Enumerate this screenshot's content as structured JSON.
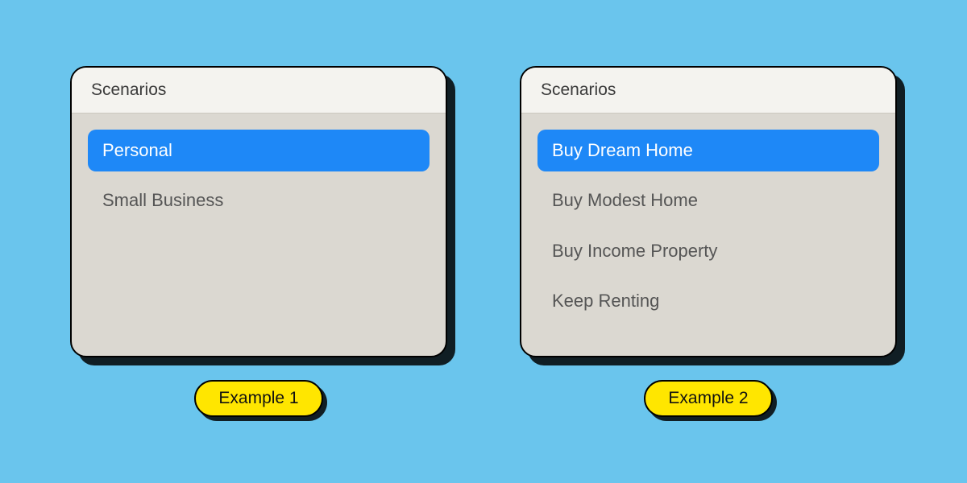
{
  "examples": [
    {
      "header": "Scenarios",
      "badge": "Example 1",
      "items": [
        {
          "label": "Personal",
          "selected": true
        },
        {
          "label": "Small Business",
          "selected": false
        }
      ]
    },
    {
      "header": "Scenarios",
      "badge": "Example 2",
      "items": [
        {
          "label": "Buy Dream Home",
          "selected": true
        },
        {
          "label": "Buy Modest Home",
          "selected": false
        },
        {
          "label": "Buy Income Property",
          "selected": false
        },
        {
          "label": "Keep Renting",
          "selected": false
        }
      ]
    }
  ]
}
